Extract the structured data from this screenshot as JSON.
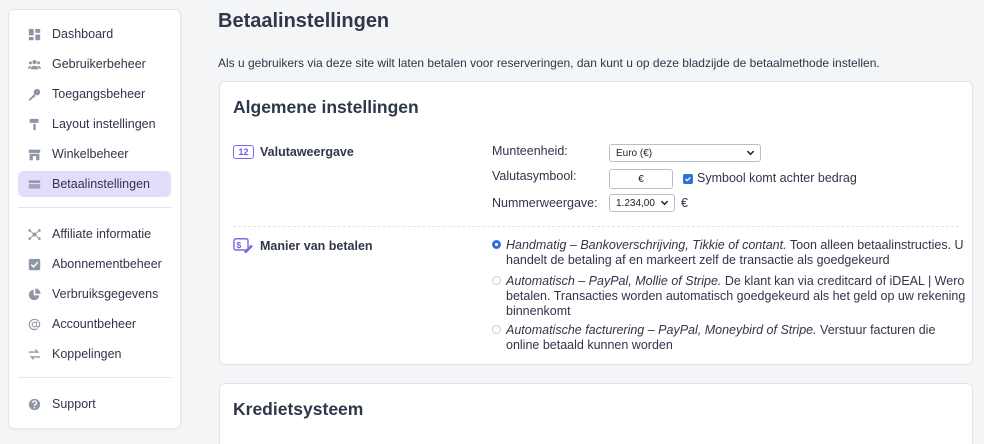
{
  "sidebar": {
    "items": [
      {
        "label": "Dashboard",
        "icon": "dashboard-icon"
      },
      {
        "label": "Gebruikerbeheer",
        "icon": "users-icon"
      },
      {
        "label": "Toegangsbeheer",
        "icon": "key-icon"
      },
      {
        "label": "Layout instellingen",
        "icon": "paint-roller-icon"
      },
      {
        "label": "Winkelbeheer",
        "icon": "store-icon"
      },
      {
        "label": "Betaalinstellingen",
        "icon": "credit-card-icon",
        "active": true
      },
      {
        "label": "Affiliate informatie",
        "icon": "affiliate-icon"
      },
      {
        "label": "Abonnementbeheer",
        "icon": "checkbox-icon"
      },
      {
        "label": "Verbruiksgegevens",
        "icon": "pie-chart-icon"
      },
      {
        "label": "Accountbeheer",
        "icon": "at-icon"
      },
      {
        "label": "Koppelingen",
        "icon": "arrows-exchange-icon"
      },
      {
        "label": "Support",
        "icon": "help-icon"
      }
    ]
  },
  "page": {
    "title": "Betaalinstellingen",
    "intro": "Als u gebruikers via deze site wilt laten betalen voor reserveringen, dan kunt u op deze bladzijde de betaalmethode instellen."
  },
  "general": {
    "title": "Algemene instellingen",
    "currency_section": {
      "badge": "12",
      "label": "Valutaweergave",
      "currency_label": "Munteenheid:",
      "currency_value": "Euro (€)",
      "symbol_label": "Valutasymbool:",
      "symbol_value": "€",
      "symbol_after_label": "Symbool komt achter bedrag",
      "symbol_after_checked": true,
      "number_label": "Nummerweergave:",
      "number_value": "1.234,00",
      "number_suffix": "€"
    },
    "payment_section": {
      "label": "Manier van betalen",
      "options": [
        {
          "title": "Handmatig – Bankoverschrijving, Tikkie of contant.",
          "desc": " Toon alleen betaalinstructies. U handelt de betaling af en markeert zelf de transactie als goedgekeurd",
          "selected": true
        },
        {
          "title": "Automatisch – PayPal, Mollie of Stripe.",
          "desc": " De klant kan via creditcard of iDEAL | Wero betalen. Transacties worden automatisch goedgekeurd als het geld op uw rekening binnenkomt",
          "selected": false
        },
        {
          "title": "Automatische facturering – PayPal, Moneybird of Stripe.",
          "desc": " Verstuur facturen die online betaald kunnen worden",
          "selected": false
        }
      ]
    }
  },
  "credit": {
    "title": "Kredietsysteem"
  },
  "colors": {
    "accent": "#6c5ce7",
    "active_bg": "#e4dcfb",
    "radio_blue": "#2f6fdf"
  }
}
